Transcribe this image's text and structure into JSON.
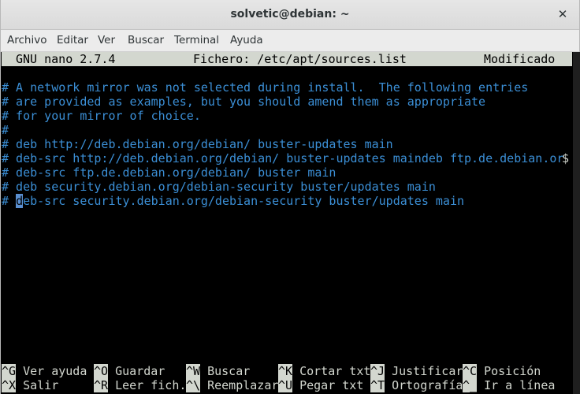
{
  "window": {
    "title": "solvetic@debian: ~",
    "close_glyph": "✕"
  },
  "menu": [
    "Archivo",
    "Editar",
    "Ver",
    "Buscar",
    "Terminal",
    "Ayuda"
  ],
  "nano": {
    "app": "GNU nano 2.7.4",
    "file": "Fichero: /etc/apt/sources.list",
    "status": "Modificado"
  },
  "content": {
    "lines": [
      "# A network mirror was not selected during install.  The following entries",
      "# are provided as examples, but you should amend them as appropriate",
      "# for your mirror of choice.",
      "#",
      "# deb http://deb.debian.org/debian/ buster-updates main",
      "# deb-src http://deb.debian.org/debian/ buster-updates maindeb ftp.de.debian.or",
      "# deb-src ftp.de.debian.org/debian/ buster main",
      "# deb security.debian.org/debian-security buster/updates main"
    ],
    "overflow_marker": "$",
    "cursor_line": {
      "prefix": "# ",
      "cursor_char": "d",
      "rest": "eb-src security.debian.org/debian-security buster/updates main"
    }
  },
  "shortcuts": [
    [
      {
        "key": "^G",
        "label": "Ver ayuda"
      },
      {
        "key": "^O",
        "label": "Guardar"
      },
      {
        "key": "^W",
        "label": "Buscar"
      },
      {
        "key": "^K",
        "label": "Cortar txt"
      },
      {
        "key": "^J",
        "label": "Justificar"
      },
      {
        "key": "^C",
        "label": "Posición"
      }
    ],
    [
      {
        "key": "^X",
        "label": "Salir"
      },
      {
        "key": "^R",
        "label": "Leer fich."
      },
      {
        "key": "^\\",
        "label": "Reemplazar"
      },
      {
        "key": "^U",
        "label": "Pegar txt"
      },
      {
        "key": "^T",
        "label": "Ortografía"
      },
      {
        "key": "^_",
        "label": "Ir a línea"
      }
    ]
  ],
  "colors": {
    "comment": "#3b8fd6",
    "header_bg": "#d3d7cf",
    "terminal_bg": "#000000"
  }
}
